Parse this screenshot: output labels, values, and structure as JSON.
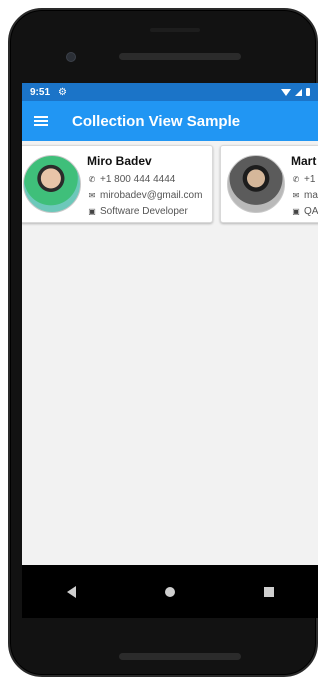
{
  "status": {
    "time": "9:51"
  },
  "app": {
    "title": "Collection View Sample"
  },
  "contacts": [
    {
      "name": "Miro Badev",
      "phone": "+1 800 444 4444",
      "email": "mirobadev@gmail.com",
      "title": "Software Developer"
    },
    {
      "name": "Mart",
      "phone": "+1",
      "email": "ma",
      "title": "QA"
    }
  ],
  "icons": {
    "phone": "phone-icon",
    "email": "email-icon",
    "title": "badge-icon"
  },
  "colors": {
    "appbar": "#2196f3",
    "statusbar": "#1b74c8"
  }
}
